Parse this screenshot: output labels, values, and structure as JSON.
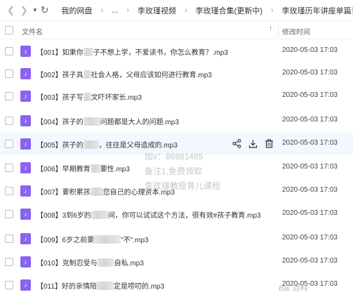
{
  "nav": {
    "breadcrumbs": [
      "我的网盘",
      "...",
      "李玫瑾视频",
      "李玫瑾合集(更新中)",
      "李玫瑾历年讲座单篇音频"
    ],
    "separator": "›"
  },
  "header": {
    "name_label": "文件名",
    "time_label": "修改时间"
  },
  "files": [
    {
      "pre": "【001】如果你",
      "post": "子不想上学，不爱读书，你怎么教育？.mp3",
      "time": "2020-05-03 17:03"
    },
    {
      "pre": "【002】孩子具",
      "post": "社会人格，父母应该如何进行教育.mp3",
      "time": "2020-05-03 17:03"
    },
    {
      "pre": "【003】孩子写",
      "post": "文吓坏家长.mp3",
      "time": "2020-05-03 17:03"
    },
    {
      "pre": "【004】孩子的",
      "post": "问题都是大人的问题.mp3",
      "time": "2020-05-03 17:03"
    },
    {
      "pre": "【005】孩子的",
      "post": "，往往是父母造成的.mp3",
      "time": "2020-05-03 17:03"
    },
    {
      "pre": "【006】早期教育",
      "post": "要性.mp3",
      "time": "2020-05-03 17:03"
    },
    {
      "pre": "【007】要积累孩",
      "post": "您自己的心理资本.mp3",
      "time": "2020-05-03 17:03"
    },
    {
      "pre": "【008】3到6岁的",
      "post": "间，你可以试试这个方法，很有效#孩子教育.mp3",
      "time": "2020-05-03 17:03"
    },
    {
      "pre": "【009】6岁之前要",
      "post": "\"不\".mp3",
      "time": "2020-05-03 17:03"
    },
    {
      "pre": "【010】克制忍受与",
      "post": "自私.mp3",
      "time": "2020-05-03 17:03"
    },
    {
      "pre": "【011】好的亲情陪",
      "post": "定是唠叨的.mp3",
      "time": "2020-05-03 17:03"
    }
  ],
  "watermark": {
    "line1": "加v：86881485",
    "line2": "备注1,免费领取",
    "line3": "李玫瑾教授育儿课程",
    "logo": "Bai 百科"
  },
  "colors": {
    "audio_icon": "#8a63f0",
    "hover_row": "#f3f7ff",
    "sort_arrow": "#4c8bf5"
  }
}
